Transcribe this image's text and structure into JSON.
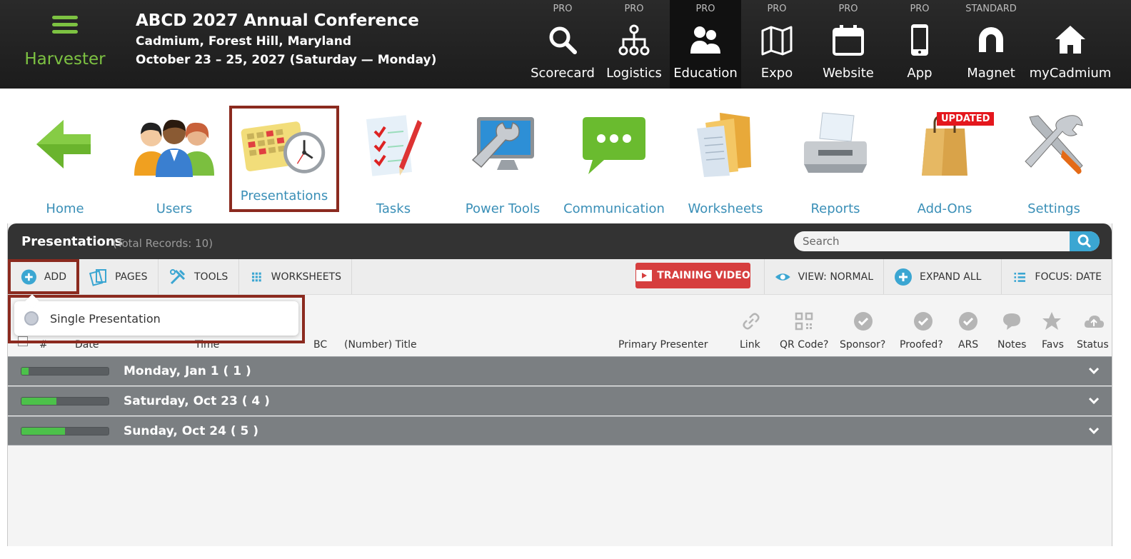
{
  "brand": {
    "name": "Harvester"
  },
  "event": {
    "title": "ABCD 2027 Annual Conference",
    "location": "Cadmium, Forest Hill, Maryland",
    "dates": "October 23 – 25, 2027 (Saturday — Monday)"
  },
  "modules": [
    {
      "tier": "PRO",
      "label": "Scorecard",
      "icon": "search-icon"
    },
    {
      "tier": "PRO",
      "label": "Logistics",
      "icon": "org-chart-icon"
    },
    {
      "tier": "PRO",
      "label": "Education",
      "icon": "people-icon",
      "active": true
    },
    {
      "tier": "PRO",
      "label": "Expo",
      "icon": "map-icon"
    },
    {
      "tier": "PRO",
      "label": "Website",
      "icon": "calendar-icon"
    },
    {
      "tier": "PRO",
      "label": "App",
      "icon": "phone-icon"
    },
    {
      "tier": "STANDARD",
      "label": "Magnet",
      "icon": "magnet-icon"
    },
    {
      "tier": "",
      "label": "myCadmium",
      "icon": "home-icon"
    }
  ],
  "apps": [
    {
      "label": "Home",
      "icon": "arrow-left-icon"
    },
    {
      "label": "Users",
      "icon": "users-icon"
    },
    {
      "label": "Presentations",
      "icon": "calendar-clock-icon",
      "selected": true
    },
    {
      "label": "Tasks",
      "icon": "checklist-icon"
    },
    {
      "label": "Power Tools",
      "icon": "wrench-monitor-icon"
    },
    {
      "label": "Communication",
      "icon": "chat-bubble-icon"
    },
    {
      "label": "Worksheets",
      "icon": "folder-icon"
    },
    {
      "label": "Reports",
      "icon": "printer-icon"
    },
    {
      "label": "Add-Ons",
      "icon": "shopping-bag-icon",
      "badge": "UPDATED"
    },
    {
      "label": "Settings",
      "icon": "tools-icon"
    }
  ],
  "panel": {
    "title": "Presentations",
    "count": "(Total Records: 10)",
    "search_placeholder": "Search"
  },
  "toolbar": {
    "add": "ADD",
    "pages": "PAGES",
    "tools": "TOOLS",
    "worksheets": "WORKSHEETS",
    "training": "TRAINING VIDEO",
    "view": "VIEW: NORMAL",
    "expand": "EXPAND ALL",
    "focus": "FOCUS: DATE"
  },
  "dropdown": {
    "item": "Single Presentation"
  },
  "columns": {
    "num": "#",
    "date": "Date",
    "time": "Time",
    "bc": "BC",
    "title": "(Number) Title",
    "presenter": "Primary Presenter",
    "link": "Link",
    "qr": "QR Code?",
    "sponsor": "Sponsor?",
    "proofed": "Proofed?",
    "ars": "ARS",
    "notes": "Notes",
    "favs": "Favs",
    "status": "Status"
  },
  "groups": [
    {
      "label": "Monday, Jan 1   ( 1 )",
      "progress": 0.08
    },
    {
      "label": "Saturday, Oct 23   ( 4 )",
      "progress": 0.4
    },
    {
      "label": "Sunday, Oct 24   ( 5 )",
      "progress": 0.5
    }
  ],
  "colors": {
    "brand_green": "#7dc242",
    "link_blue": "#3a8fb7",
    "highlight": "#8b2a1f",
    "training_red": "#d63e3e",
    "search_blue": "#3ba6d2"
  }
}
